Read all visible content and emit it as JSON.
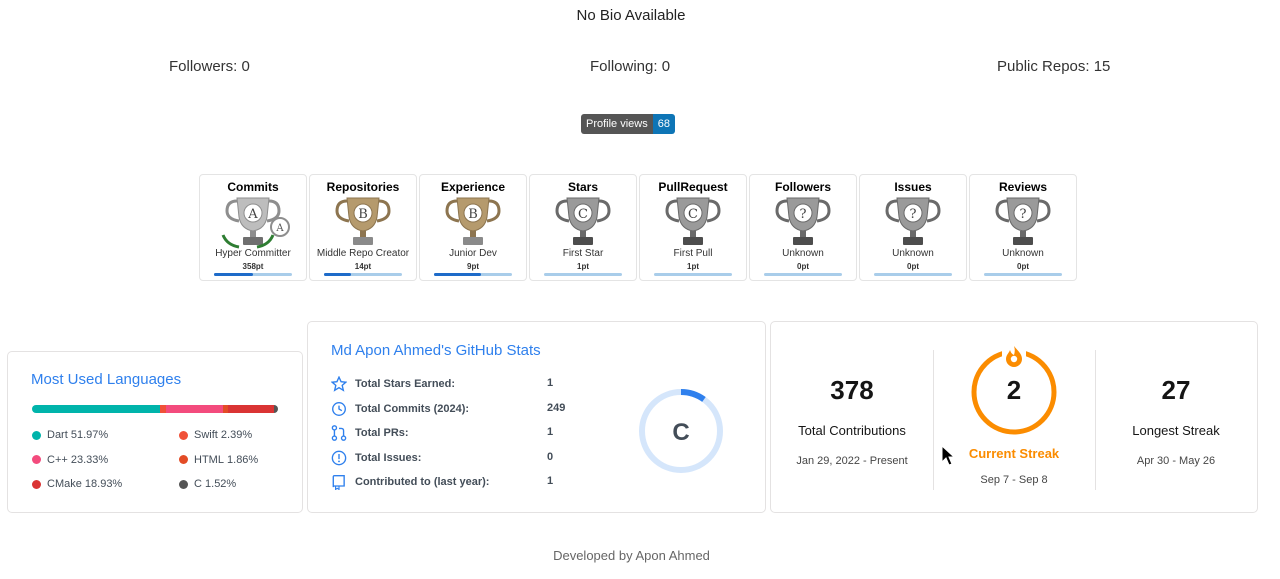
{
  "profile": {
    "bio": "No Bio Available",
    "followers": "Followers: 0",
    "following": "Following: 0",
    "public_repos": "Public Repos: 15",
    "views_label": "Profile views",
    "views_count": "68"
  },
  "trophies": [
    {
      "title": "Commits",
      "grade": "A",
      "rank": "Hyper Committer",
      "points": "358pt",
      "progress": 0.5,
      "tier": "silver"
    },
    {
      "title": "Repositories",
      "grade": "B",
      "rank": "Middle Repo Creator",
      "points": "14pt",
      "progress": 0.35,
      "tier": "bronze"
    },
    {
      "title": "Experience",
      "grade": "B",
      "rank": "Junior Dev",
      "points": "9pt",
      "progress": 0.6,
      "tier": "bronze"
    },
    {
      "title": "Stars",
      "grade": "C",
      "rank": "First Star",
      "points": "1pt",
      "progress": 0.0,
      "tier": "gray"
    },
    {
      "title": "PullRequest",
      "grade": "C",
      "rank": "First Pull",
      "points": "1pt",
      "progress": 0.0,
      "tier": "gray"
    },
    {
      "title": "Followers",
      "grade": "?",
      "rank": "Unknown",
      "points": "0pt",
      "progress": 0.0,
      "tier": "gray"
    },
    {
      "title": "Issues",
      "grade": "?",
      "rank": "Unknown",
      "points": "0pt",
      "progress": 0.0,
      "tier": "gray"
    },
    {
      "title": "Reviews",
      "grade": "?",
      "rank": "Unknown",
      "points": "0pt",
      "progress": 0.0,
      "tier": "gray"
    }
  ],
  "languages": {
    "title": "Most Used Languages",
    "items": [
      {
        "name": "Dart",
        "percent": "51.97%",
        "value": 51.97,
        "color": "#00B4AB"
      },
      {
        "name": "Swift",
        "percent": "2.39%",
        "value": 2.39,
        "color": "#F05138"
      },
      {
        "name": "C++",
        "percent": "23.33%",
        "value": 23.33,
        "color": "#f34b7d"
      },
      {
        "name": "HTML",
        "percent": "1.86%",
        "value": 1.86,
        "color": "#e34c26"
      },
      {
        "name": "CMake",
        "percent": "18.93%",
        "value": 18.93,
        "color": "#DA3434"
      },
      {
        "name": "C",
        "percent": "1.52%",
        "value": 1.52,
        "color": "#555555"
      }
    ]
  },
  "github_stats": {
    "title": "Md Apon Ahmed's GitHub Stats",
    "rows": [
      {
        "label": "Total Stars Earned:",
        "value": "1",
        "icon": "star-icon"
      },
      {
        "label": "Total Commits (2024):",
        "value": "249",
        "icon": "history-icon"
      },
      {
        "label": "Total PRs:",
        "value": "1",
        "icon": "pull-request-icon"
      },
      {
        "label": "Total Issues:",
        "value": "0",
        "icon": "issue-icon"
      },
      {
        "label": "Contributed to (last year):",
        "value": "1",
        "icon": "repo-icon"
      }
    ],
    "rank": "C",
    "rank_progress": 0.1
  },
  "streak": {
    "total_contributions": "378",
    "total_label": "Total Contributions",
    "total_range": "Jan 29, 2022 - Present",
    "current_streak": "2",
    "current_label": "Current Streak",
    "current_range": "Sep 7 - Sep 8",
    "longest_streak": "27",
    "longest_label": "Longest Streak",
    "longest_range": "Apr 30 - May 26",
    "accent": "#FB8C00"
  },
  "footer": "Developed by Apon Ahmed"
}
